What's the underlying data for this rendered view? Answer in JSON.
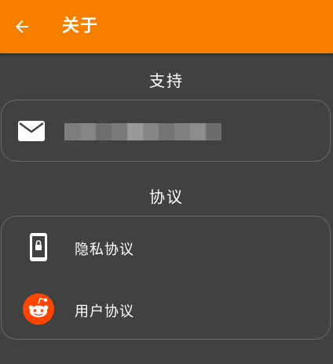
{
  "app_bar": {
    "title": "关于",
    "back_icon": "arrow-left-icon",
    "color": "#f77f00"
  },
  "support": {
    "header": "支持",
    "email_icon": "mail-icon"
  },
  "agreements": {
    "header": "协议",
    "items": [
      {
        "label": "隐私协议",
        "icon": "phone-lock-icon"
      },
      {
        "label": "用户协议",
        "icon": "reddit-icon"
      }
    ]
  },
  "colors": {
    "background": "#414141",
    "card_border": "#6a6a6a",
    "reddit_orange": "#ff4500"
  }
}
